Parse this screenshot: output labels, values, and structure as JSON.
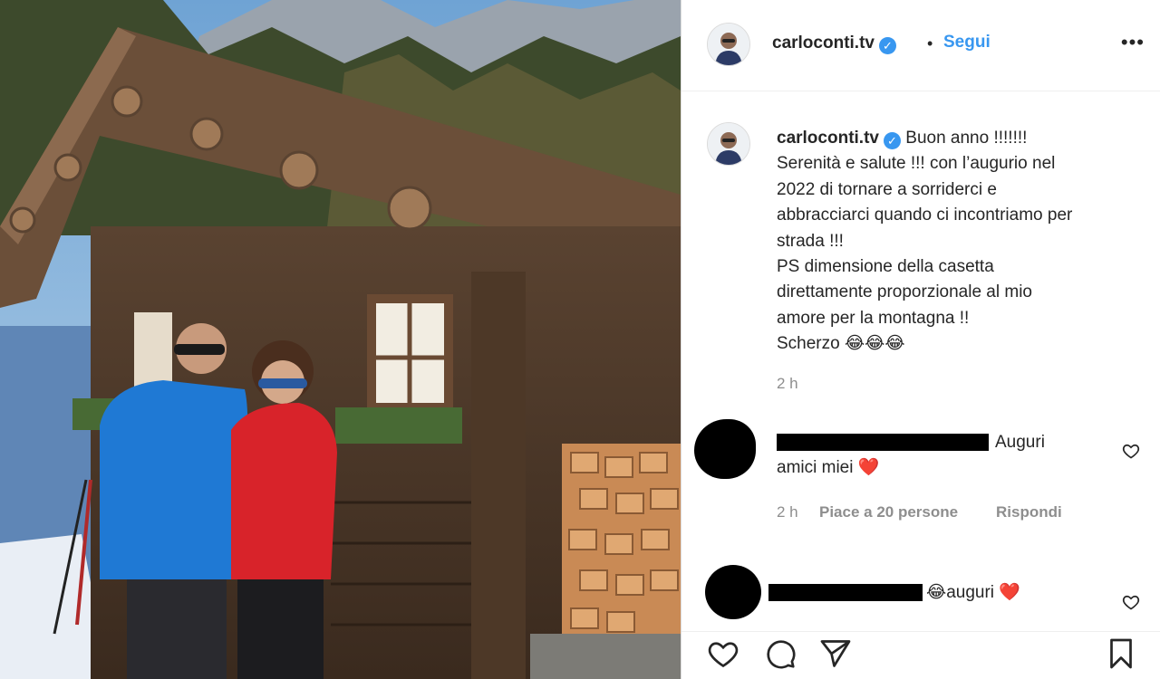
{
  "post": {
    "author": "carloconti.tv",
    "verified_icon": "verified-badge-icon",
    "follow_label": "Segui",
    "separator": "•",
    "more_label": "•••"
  },
  "caption": {
    "author": "carloconti.tv",
    "text": "Buon anno !!!!!!!\nSerenità e salute !!! con l’augurio nel\n2022 di tornare a sorriderci e\nabbracciarci quando ci incontriamo per\nstrada !!!\nPS dimensione della casetta\ndirettamente proporzionale al mio\namore per la montagna !!\nScherzo 😂😂😂",
    "time": "2 h"
  },
  "comments": [
    {
      "text_line1": "Auguri",
      "text_line2": "amici miei ❤️",
      "time": "2 h",
      "likes": "Piace a 20 persone",
      "reply": "Rispondi"
    },
    {
      "text": "😂auguri ❤️"
    }
  ],
  "actions": {
    "like_icon": "heart-icon",
    "comment_icon": "comment-icon",
    "share_icon": "send-icon",
    "save_icon": "bookmark-icon"
  },
  "colors": {
    "link_blue": "#3897f0",
    "secondary_text": "#8e8e8e",
    "primary_text": "#262626",
    "heart_red": "#e0152f"
  }
}
